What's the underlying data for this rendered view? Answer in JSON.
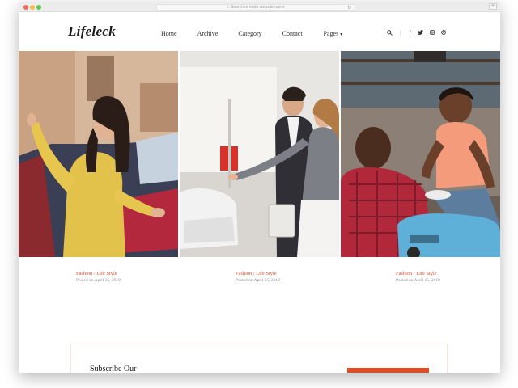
{
  "browser": {
    "address_placeholder": "Search or enter website name"
  },
  "site": {
    "logo": "Lifeleck"
  },
  "nav": {
    "items": [
      {
        "label": "Home"
      },
      {
        "label": "Archive"
      },
      {
        "label": "Category"
      },
      {
        "label": "Contact"
      },
      {
        "label": "Pages"
      }
    ],
    "dropdown_caret": "▾"
  },
  "header_tools": {
    "icons": [
      "search-icon",
      "facebook-icon",
      "twitter-icon",
      "instagram-icon",
      "dribbble-icon"
    ]
  },
  "posts": [
    {
      "category": "Fashion / Life Style",
      "date": "Posted on April 15, 2019",
      "image": "woman-laughing-by-car"
    },
    {
      "category": "Fashion / Life Style",
      "date": "Posted on April 15, 2019",
      "image": "couple-at-car-showroom"
    },
    {
      "category": "Fashion / Life Style",
      "date": "Posted on April 15, 2019",
      "image": "father-and-son-playing"
    }
  ],
  "subscribe": {
    "title": "Subscribe Our"
  },
  "colors": {
    "accent": "#e34c22",
    "category_text": "#d9502c",
    "text_dark": "#1c1c1c"
  }
}
